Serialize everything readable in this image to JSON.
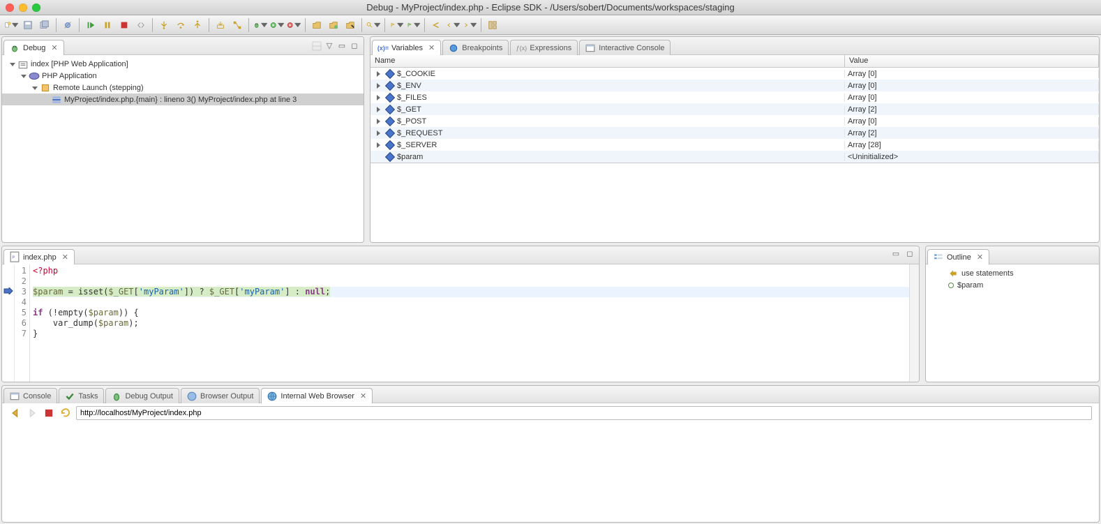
{
  "window": {
    "title": "Debug - MyProject/index.php - Eclipse SDK - /Users/sobert/Documents/workspaces/staging"
  },
  "debug_view": {
    "tab": "Debug",
    "tree": {
      "root": "index [PHP Web Application]",
      "child1": "PHP Application",
      "child2": "Remote Launch (stepping)",
      "child3": "MyProject/index.php.{main} : lineno 3() MyProject/index.php at line 3"
    }
  },
  "vars_view": {
    "tabs": {
      "variables": "Variables",
      "breakpoints": "Breakpoints",
      "expressions": "Expressions",
      "console": "Interactive Console"
    },
    "headers": {
      "name": "Name",
      "value": "Value"
    },
    "rows": [
      {
        "name": "$_COOKIE",
        "value": "Array [0]",
        "expandable": true
      },
      {
        "name": "$_ENV",
        "value": "Array [0]",
        "expandable": true
      },
      {
        "name": "$_FILES",
        "value": "Array [0]",
        "expandable": true
      },
      {
        "name": "$_GET",
        "value": "Array [2]",
        "expandable": true
      },
      {
        "name": "$_POST",
        "value": "Array [0]",
        "expandable": true
      },
      {
        "name": "$_REQUEST",
        "value": "Array [2]",
        "expandable": true
      },
      {
        "name": "$_SERVER",
        "value": "Array [28]",
        "expandable": true
      },
      {
        "name": "$param",
        "value": "<Uninitialized>",
        "expandable": false
      }
    ]
  },
  "editor": {
    "tab": "index.php",
    "lines": [
      "1",
      "2",
      "3",
      "4",
      "5",
      "6",
      "7"
    ],
    "code": {
      "l1": "<?php",
      "l3_a": "$param",
      "l3_b": " = ",
      "l3_c": "isset",
      "l3_d": "(",
      "l3_e": "$_GET",
      "l3_f": "[",
      "l3_g": "'myParam'",
      "l3_h": "]) ? ",
      "l3_i": "$_GET",
      "l3_j": "[",
      "l3_k": "'myParam'",
      "l3_l": "] : ",
      "l3_m": "null",
      "l3_n": ";",
      "l5_a": "if",
      "l5_b": " (!",
      "l5_c": "empty",
      "l5_d": "(",
      "l5_e": "$param",
      "l5_f": ")) {",
      "l6_a": "    var_dump(",
      "l6_b": "$param",
      "l6_c": ");",
      "l7": "}"
    }
  },
  "outline": {
    "tab": "Outline",
    "items": {
      "use": "use statements",
      "param": "$param"
    }
  },
  "bottom": {
    "tabs": {
      "console": "Console",
      "tasks": "Tasks",
      "debug_output": "Debug Output",
      "browser_output": "Browser Output",
      "browser": "Internal Web Browser"
    },
    "url": "http://localhost/MyProject/index.php"
  }
}
